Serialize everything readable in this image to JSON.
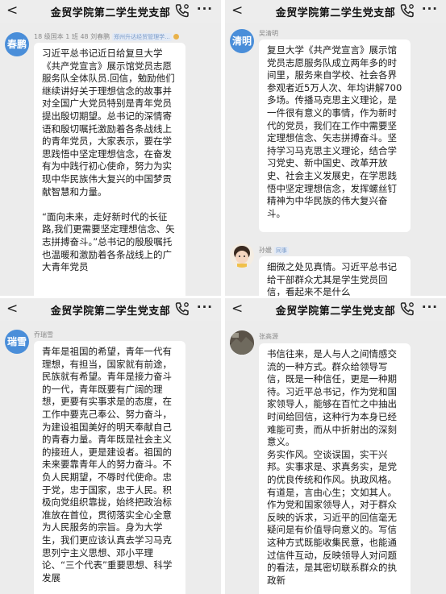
{
  "header": {
    "back_icon": "chevron-left-icon",
    "title": "金贸学院第二学生党支部",
    "call_icon": "phone-settings-icon",
    "more_icon": "more-dots-icon",
    "back_glyph": "<",
    "more_glyph": "···"
  },
  "panels": [
    {
      "avatar_label": "春鹏",
      "avatar_color": "#4a8ed9",
      "sender_name": "18 级国本 1 班 48 刘春鹏",
      "sender_tag": "郑州升达经贸管理学...",
      "message": "习近平总书记近日给复旦大学《共产党宣言》展示馆党员志愿服务队全体队员.回信，勉励他们继续讲好关于理想信念的故事并对全国广大党员特别是青年党员提出殷切期望。总书记的深情寄语和殷切嘱托激励着各条战线上的青年党员，大家表示，要在学思践悟中坚定理想信念，在奋发有为中践行初心使命，努力为实现中华民族伟大复兴的中国梦贡献智慧和力量。\n\n“面向未来，走好新时代的长征路,我们更需要坚定理想信念、矢志拼搏奋斗。”总书记的殷殷嘱托也温暖和激励着各条战线上的广大青年党员"
    },
    {
      "avatar_label": "清明",
      "avatar_color": "#4a8ed9",
      "sender_name": "吴清明",
      "message": "复旦大学《共产党宣言》展示馆党员志愿服务队成立两年多的时间里，服务来自学校、社会各界参观者近5万人次、年均讲解700多场。传播马克思主义理论，是一件很有意义的事情，作为新时代的党员，我们在工作中需要坚定理想信念、矢志拼搏奋斗。坚持学习马克思主义理论，结合学习党史、新中国史、改革开放史、社会主义发展史，在学思践悟中坚定理想信念，发挥螺丝钉精神为中华民族的伟大复兴奋斗。",
      "second_sender_name": "孙媛",
      "second_sender_tag": "同事",
      "second_message": "细微之处见真情。习近平总书记给干部群众尤其是学生党员回信，看起来不是什么"
    },
    {
      "avatar_label": "瑞雪",
      "avatar_color": "#4a8ed9",
      "sender_name": "乔瑞雪",
      "message": "青年是祖国的希望，青年一代有理想，有担当，国家就有前途，民族就有希望。青年是接力奋斗的一代，青年既要有广阔的理想，更要有实事求是的态度，在工作中要克己奉公、努力奋斗，为建设祖国美好的明天奉献自己的青春力量。青年既是社会主义的接班人，更是建设者。祖国的未来要靠青年人的努力奋斗。不负人民期望，不辱时代使命。忠于党，忠于国家，忠于人民。积极向党组织靠拢，始终把政治标准放在首位，贯彻落实全心全意为人民服务的宗旨。身为大学生，我们更应该认真去学习马克思列宁主义思想、邓小平理论、“三个代表”重要思想、科学发展"
    },
    {
      "sender_name": "张高源",
      "message": "书信往来，是人与人之间情感交流的一种方式。群众给领导写信，既是一种信任，更是一种期待。习近平总书记，作为党和国家领导人，能够在百忙之中抽出时间给回信，这种行为本身已经难能可贵，而从中折射出的深刻意义。\n务实作风。空谈误国，实干兴邦。实事求是、求真务实，是党的优良传统和作风。执政风格。有道是，言由心生；文如其人。作为党和国家领导人，对于群众反映的诉求，习近平的回信毫无疑问是有价值导向意义的。写信这种方式既能收集民意，也能通过信件互动，反映领导人对问题的看法，是其密切联系群众的执政新"
    }
  ]
}
